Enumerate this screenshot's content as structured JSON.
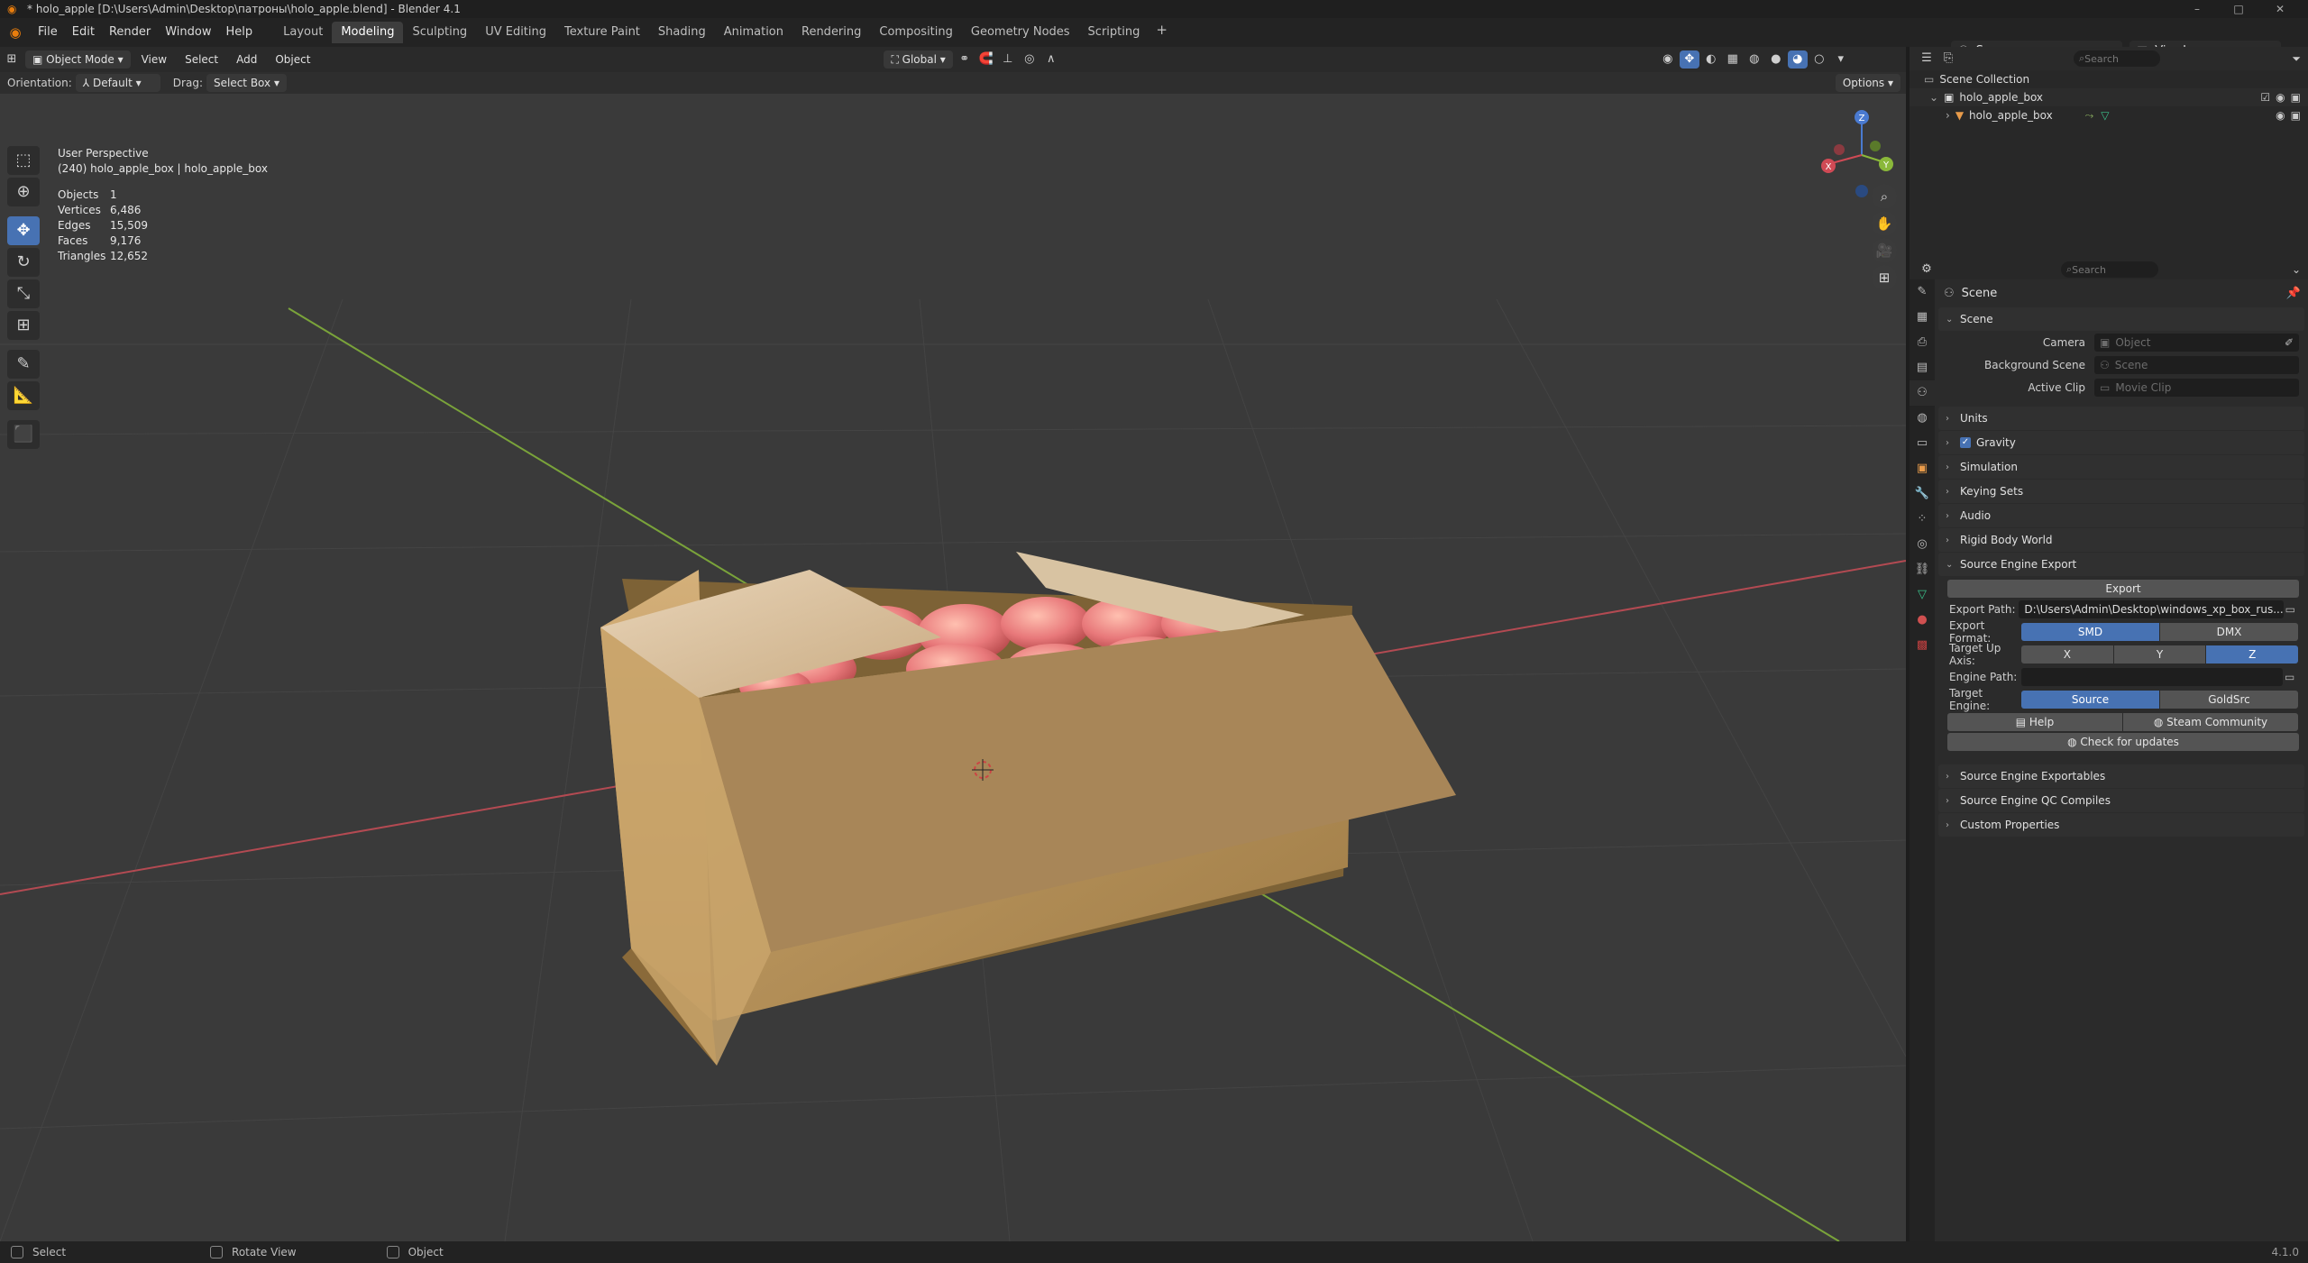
{
  "window": {
    "title": "* holo_apple [D:\\Users\\Admin\\Desktop\\патроны\\holo_apple.blend] - Blender 4.1",
    "controls": [
      "–",
      "□",
      "✕"
    ]
  },
  "menu": [
    "File",
    "Edit",
    "Render",
    "Window",
    "Help"
  ],
  "workspaces": [
    "Layout",
    "Modeling",
    "Sculpting",
    "UV Editing",
    "Texture Paint",
    "Shading",
    "Animation",
    "Rendering",
    "Compositing",
    "Geometry Nodes",
    "Scripting"
  ],
  "active_workspace": "Modeling",
  "scene_selector": "Scene",
  "view_layer": "ViewLayer",
  "viewport_header": {
    "mode": "Object Mode",
    "menus": [
      "View",
      "Select",
      "Add",
      "Object"
    ],
    "transform_orientation": "Global"
  },
  "tool_settings": {
    "orientation_label": "Orientation:",
    "orientation_value": "Default",
    "drag_label": "Drag:",
    "drag_value": "Select Box",
    "options": "Options"
  },
  "overlay": {
    "view_name": "User Perspective",
    "object_info": "(240) holo_apple_box | holo_apple_box",
    "stats": [
      {
        "label": "Objects",
        "value": "1"
      },
      {
        "label": "Vertices",
        "value": "6,486"
      },
      {
        "label": "Edges",
        "value": "15,509"
      },
      {
        "label": "Faces",
        "value": "9,176"
      },
      {
        "label": "Triangles",
        "value": "12,652"
      }
    ]
  },
  "gizmo": {
    "x": "X",
    "y": "Y",
    "z": "Z"
  },
  "outliner": {
    "search_placeholder": "Search",
    "root": "Scene Collection",
    "collection": "holo_apple_box",
    "object": "holo_apple_box"
  },
  "properties": {
    "search_placeholder": "Search",
    "context": "Scene",
    "scene_panel": "Scene",
    "camera_label": "Camera",
    "camera_placeholder": "Object",
    "background_label": "Background Scene",
    "background_placeholder": "Scene",
    "clip_label": "Active Clip",
    "clip_placeholder": "Movie Clip",
    "panels": [
      "Units",
      "Gravity",
      "Simulation",
      "Keying Sets",
      "Audio",
      "Rigid Body World",
      "Source Engine Export"
    ],
    "gravity_checked": true,
    "export": {
      "button": "Export",
      "path_label": "Export Path:",
      "path_value": "D:\\Users\\Admin\\Desktop\\windows_xp_box_rus...",
      "format_label": "Export Format:",
      "formats": [
        "SMD",
        "DMX"
      ],
      "format_selected": "SMD",
      "axis_label": "Target Up Axis:",
      "axes": [
        "X",
        "Y",
        "Z"
      ],
      "axis_selected": "Z",
      "engine_path_label": "Engine Path:",
      "engine_path_value": "",
      "target_engine_label": "Target Engine:",
      "engines": [
        "Source",
        "GoldSrc"
      ],
      "engine_selected": "Source",
      "help": "Help",
      "steam": "Steam Community",
      "updates": "Check for updates"
    },
    "panels_after": [
      "Source Engine Exportables",
      "Source Engine QC Compiles",
      "Custom Properties"
    ]
  },
  "status": {
    "select": "Select",
    "rotate": "Rotate View",
    "object": "Object",
    "version": "4.1.0"
  },
  "colors": {
    "accent": "#4772b3",
    "blender_orange": "#e87d0d",
    "viewport_bg": "#3a3a3a",
    "x_axis": "#b34a52",
    "y_axis": "#7aa33a"
  }
}
